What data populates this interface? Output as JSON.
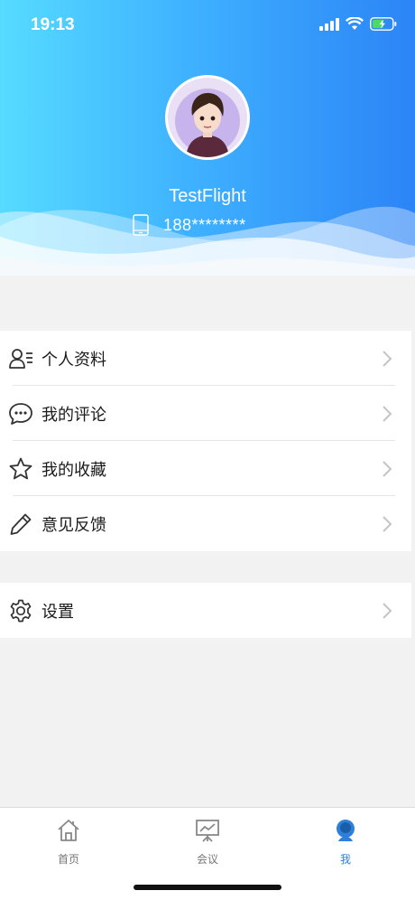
{
  "status_bar": {
    "time": "19:13"
  },
  "profile": {
    "username": "TestFlight",
    "phone": "188********"
  },
  "menu": {
    "group1": [
      {
        "label": "个人资料",
        "icon": "profile-card-icon"
      },
      {
        "label": "我的评论",
        "icon": "comment-bubble-icon"
      },
      {
        "label": "我的收藏",
        "icon": "star-icon"
      },
      {
        "label": "意见反馈",
        "icon": "pencil-icon"
      }
    ],
    "group2": [
      {
        "label": "设置",
        "icon": "gear-icon"
      }
    ]
  },
  "tabbar": {
    "tabs": [
      {
        "label": "首页",
        "icon": "home-icon",
        "active": false
      },
      {
        "label": "会议",
        "icon": "presentation-icon",
        "active": false
      },
      {
        "label": "我",
        "icon": "user-icon",
        "active": true
      }
    ]
  },
  "colors": {
    "header_gradient_start": "#56dbff",
    "header_gradient_end": "#2c84f6",
    "active_tab": "#2e7fd9",
    "background": "#f2f2f2"
  }
}
